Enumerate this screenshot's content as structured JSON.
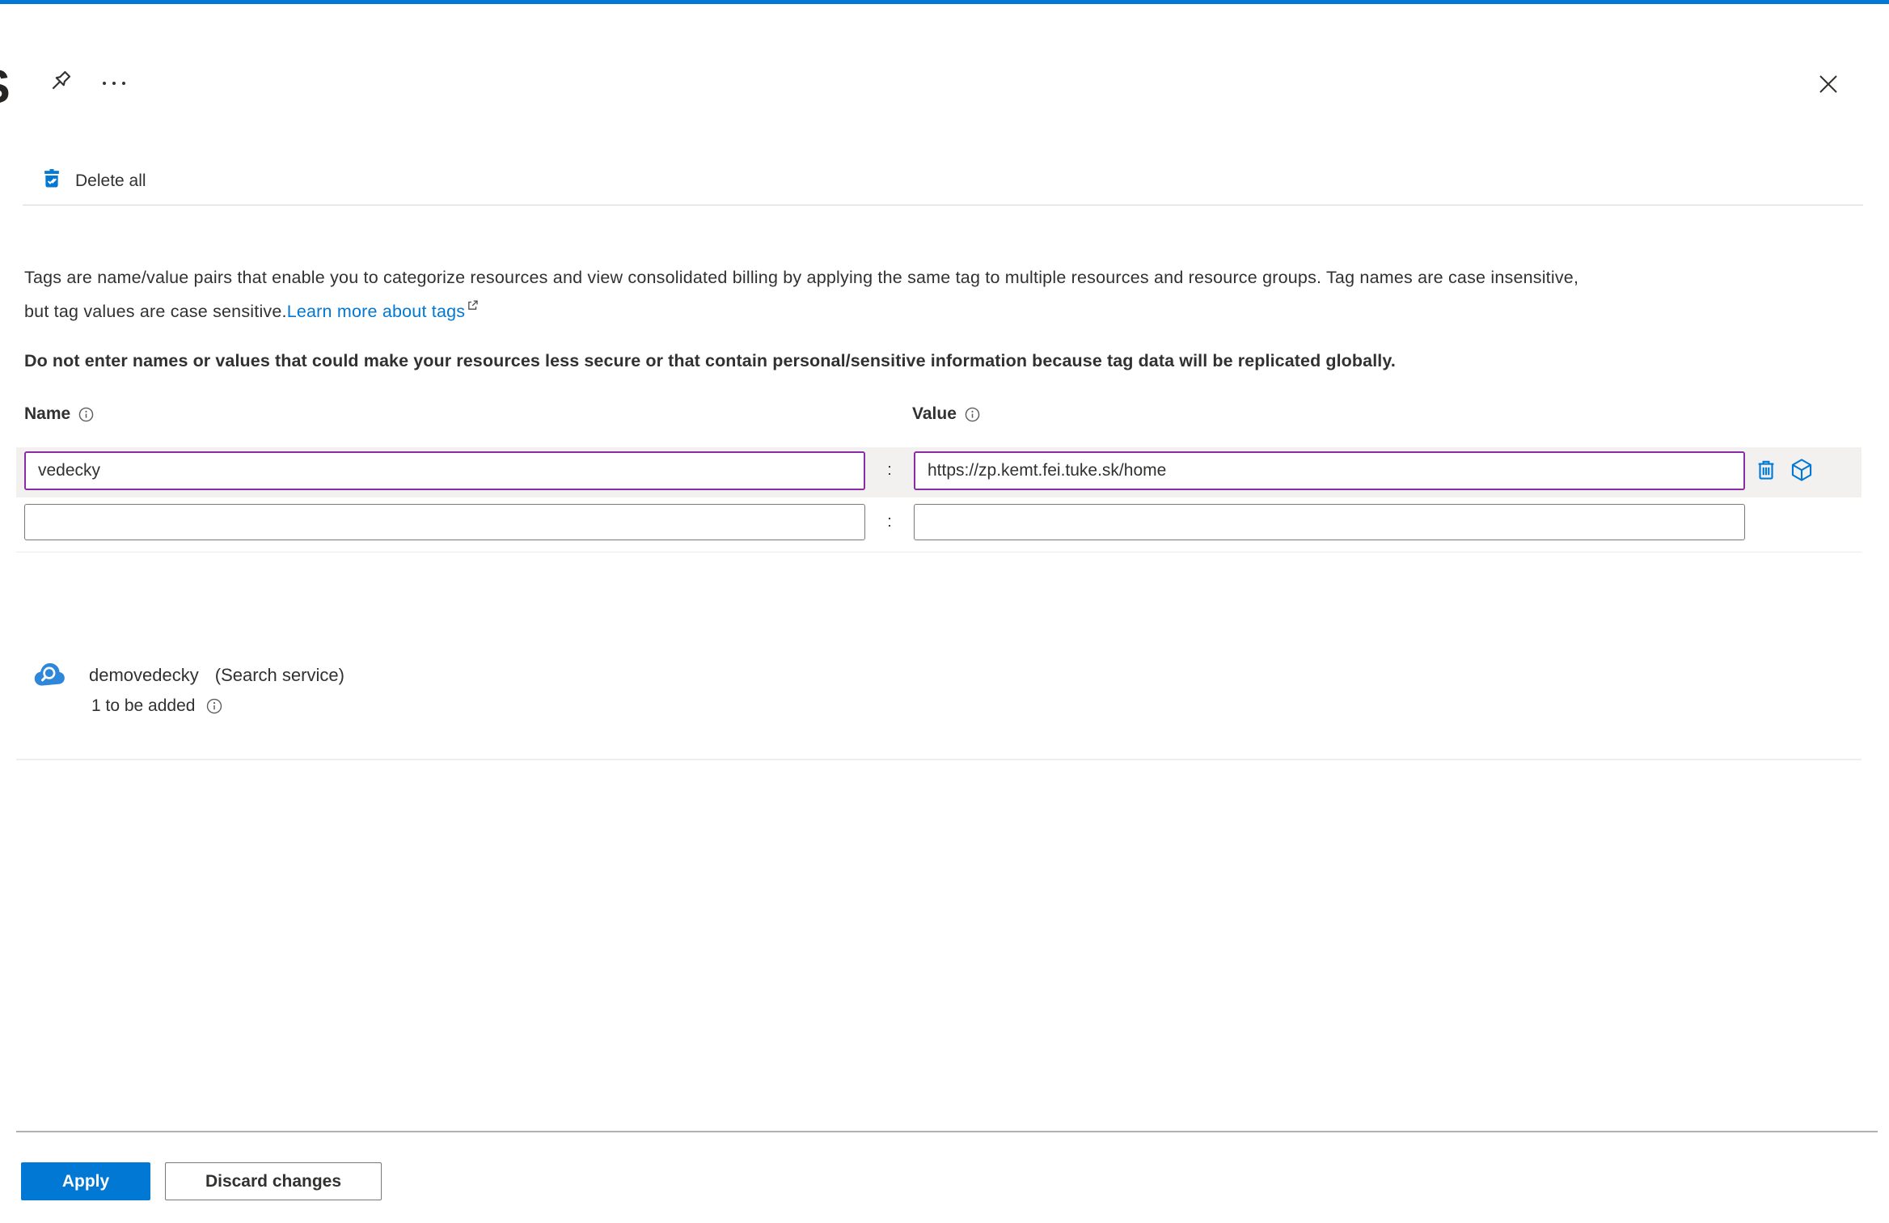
{
  "colors": {
    "accent_blue": "#0078d4",
    "modified_field_purple": "#8a2da5",
    "text": "#323130",
    "row_highlight": "#f2f1f0"
  },
  "header": {
    "title_fragment": "S"
  },
  "toolbar": {
    "delete_all_label": "Delete all"
  },
  "description": {
    "line1": "Tags are name/value pairs that enable you to categorize resources and view consolidated billing by applying the same tag to multiple resources and resource groups. Tag names are case insensitive,",
    "line2": "but tag values are case sensitive.",
    "link_label": "Learn more about tags"
  },
  "warning": "Do not enter names or values that could make your resources less secure or that contain personal/sensitive information because tag data will be replicated globally.",
  "table": {
    "name_header": "Name",
    "value_header": "Value",
    "separator": ":",
    "rows": [
      {
        "name": "vedecky",
        "value": "https://zp.kemt.fei.tuke.sk/home",
        "modified": true
      },
      {
        "name": "",
        "value": "",
        "modified": false
      }
    ]
  },
  "resource": {
    "name": "demovedecky",
    "type": "(Search service)",
    "status": "1 to be added"
  },
  "footer": {
    "apply_label": "Apply",
    "discard_label": "Discard changes"
  }
}
